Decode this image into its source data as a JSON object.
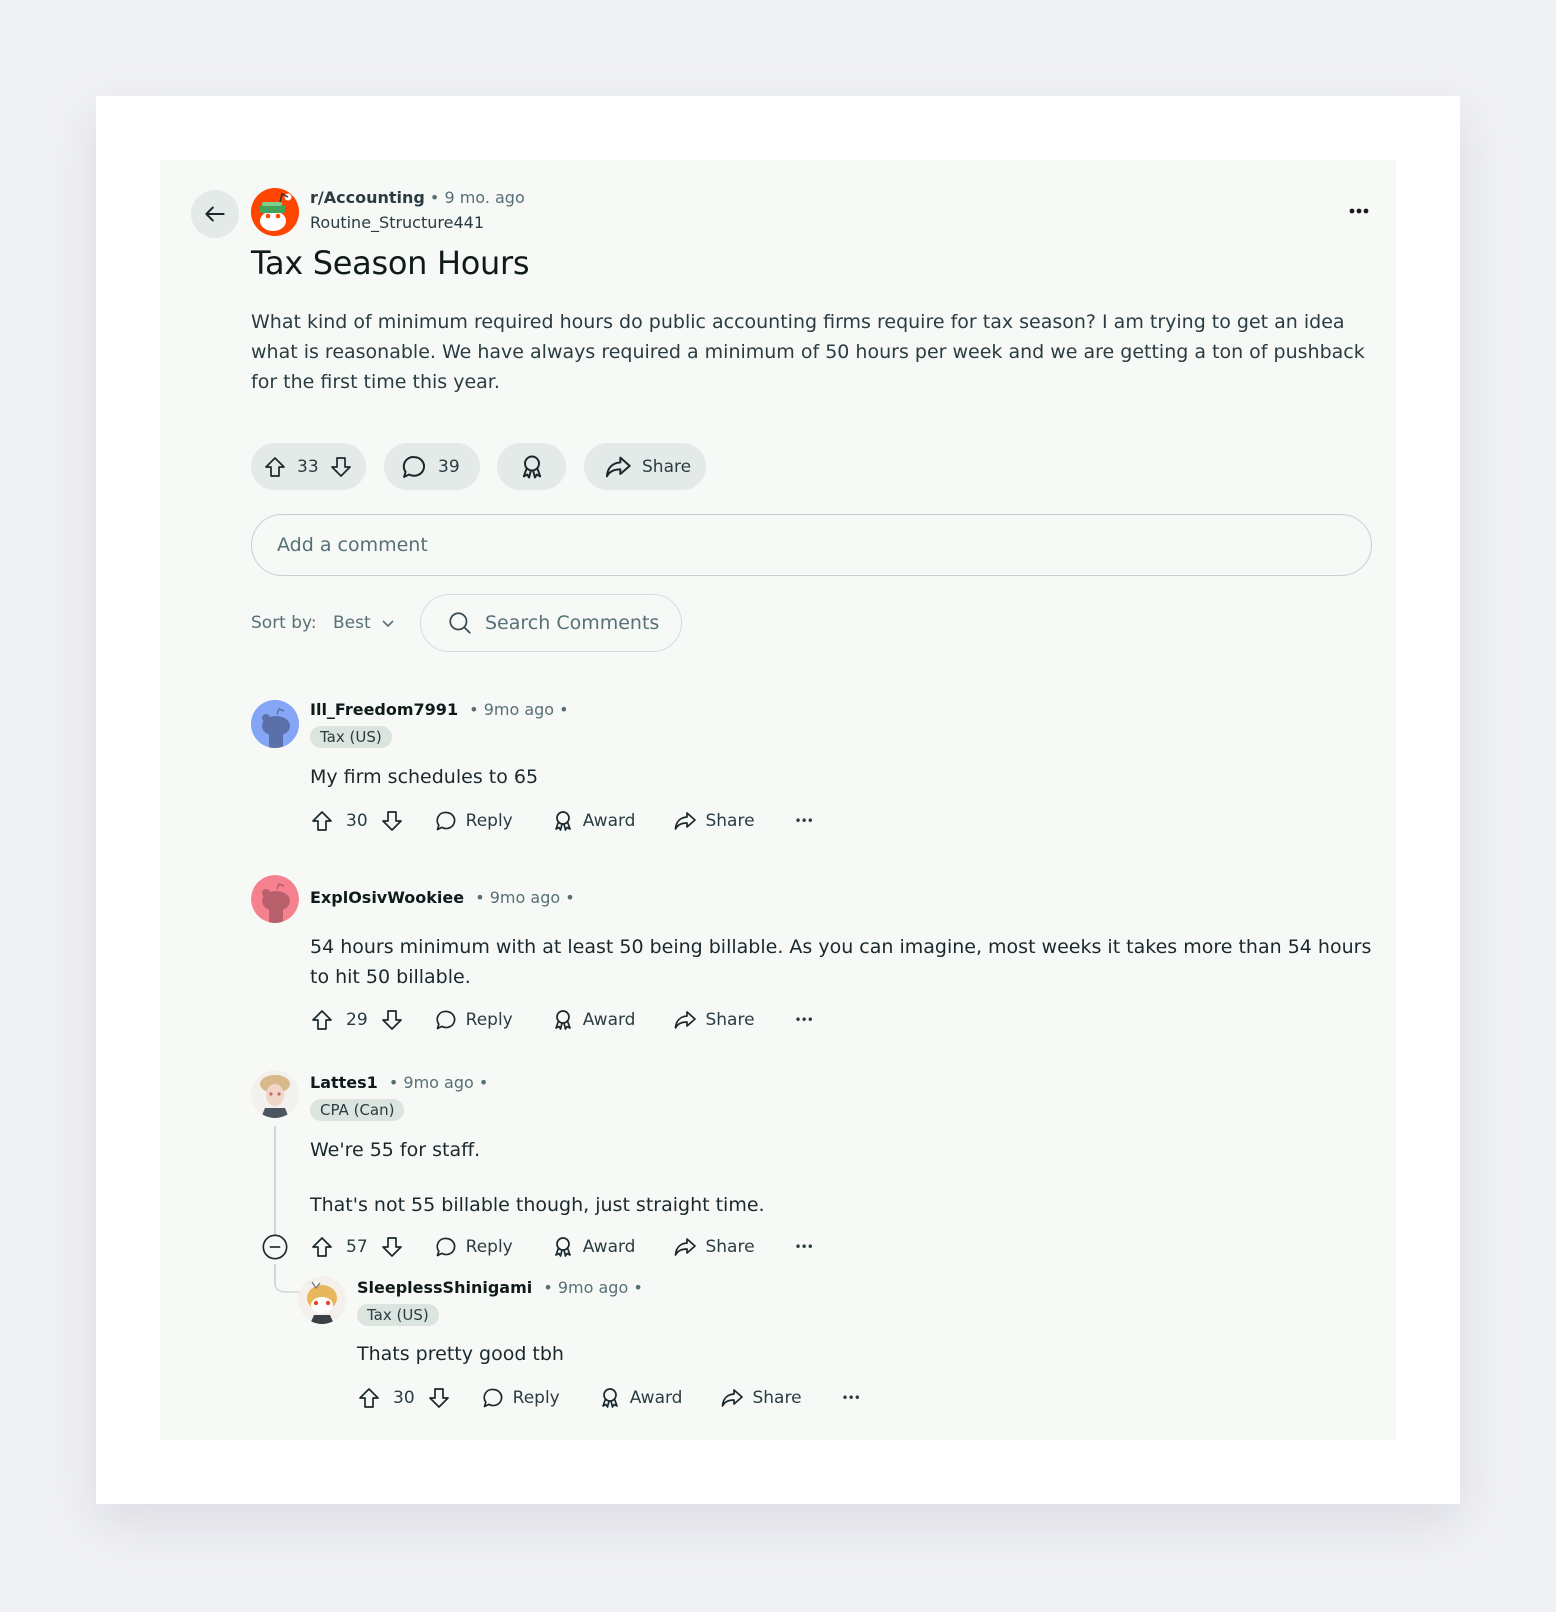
{
  "post": {
    "subreddit": "r/Accounting",
    "separator": " • ",
    "age": "9 mo. ago",
    "author": "Routine_Structure441",
    "title": "Tax Season Hours",
    "body": "What kind of minimum required hours do public accounting firms require for tax season? I am trying to get an idea what is reasonable. We have always required a minimum of 50 hours per week and we are getting a ton of pushback for the first time this year.",
    "votes": "33",
    "comments_count": "39",
    "share_label": "Share"
  },
  "icons": {
    "back": "arrow-left-icon",
    "more": "more-horizontal-icon",
    "upvote": "upvote-arrow-icon",
    "downvote": "downvote-arrow-icon",
    "comment": "speech-bubble-icon",
    "award": "award-ribbon-icon",
    "share": "share-arrow-icon",
    "search": "search-icon",
    "chevron": "chevron-down-icon",
    "collapse": "collapse-minus-circle-icon"
  },
  "comment_box": {
    "placeholder": "Add a comment"
  },
  "sort": {
    "label": "Sort by:",
    "value": "Best"
  },
  "search": {
    "placeholder": "Search Comments"
  },
  "action_labels": {
    "reply": "Reply",
    "award": "Award",
    "share": "Share",
    "more": "•••"
  },
  "comments": [
    {
      "username": "Ill_Freedom7991",
      "meta": "• 9mo ago •",
      "flair": "Tax (US)",
      "text": "My firm schedules to 65",
      "votes": "30"
    },
    {
      "username": "ExplOsivWookiee",
      "meta": "• 9mo ago •",
      "flair": "",
      "text": "54 hours minimum with at least 50 being billable. As you can imagine, most weeks it takes more than 54 hours to hit 50 billable.",
      "votes": "29"
    },
    {
      "username": "Lattes1",
      "meta": "• 9mo ago •",
      "flair": "CPA (Can)",
      "text": "We're 55 for staff.",
      "text2": "That's not 55 billable though, just straight time.",
      "votes": "57"
    },
    {
      "username": "SleeplessShinigami",
      "meta": "• 9mo ago •",
      "flair": "Tax (US)",
      "text": "Thats pretty good tbh",
      "votes": "30"
    }
  ],
  "colors": {
    "page_bg": "#f0f1f5",
    "card_bg": "#ffffff",
    "panel_bg": "#f7f9f7",
    "pill_bg": "#e3eae7",
    "flair_bg": "#dbe4df",
    "reddit_orange": "#ff4500"
  }
}
